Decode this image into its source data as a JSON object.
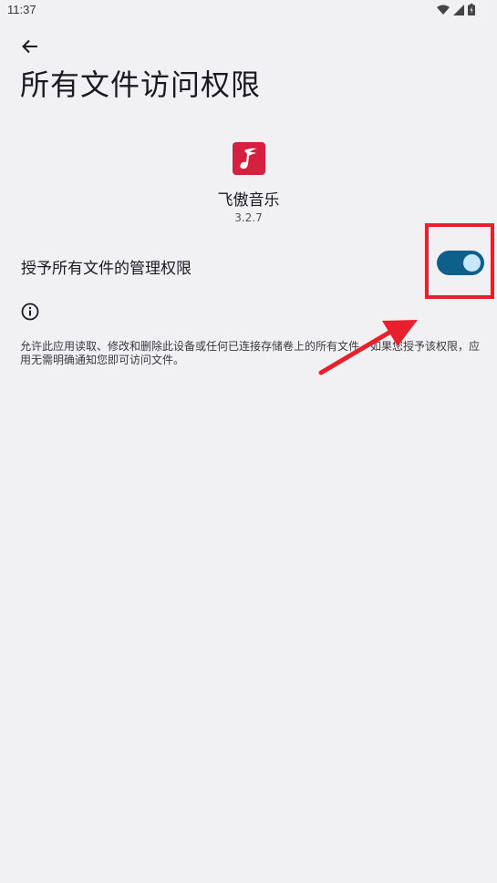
{
  "status_bar": {
    "time": "11:37"
  },
  "header": {
    "title": "所有文件访问权限"
  },
  "app": {
    "name": "飞傲音乐",
    "version": "3.2.7"
  },
  "setting": {
    "label": "授予所有文件的管理权限",
    "enabled": true
  },
  "description": "允许此应用读取、修改和删除此设备或任何已连接存储卷上的所有文件。如果您授予该权限，应用无需明确通知您即可访问文件。",
  "colors": {
    "background": "#f1f1f4",
    "toggle_track": "#0e5f8a",
    "toggle_knob": "#c7e7ff",
    "app_icon": "#d6203f",
    "annotation": "#e8202b"
  },
  "icons": [
    "wifi-icon",
    "signal-icon",
    "battery-icon",
    "back-arrow-icon",
    "app-logo-icon",
    "info-icon",
    "annotation-arrow-icon"
  ]
}
